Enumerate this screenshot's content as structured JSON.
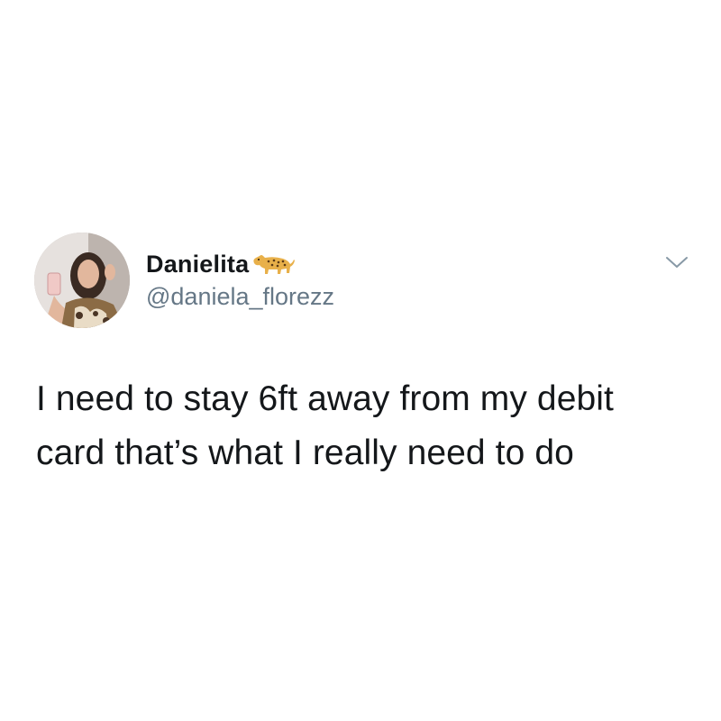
{
  "tweet": {
    "author": {
      "display_name": "Danielita",
      "emoji_icon": "leopard-icon",
      "handle": "@daniela_florezz",
      "avatar_icon": "profile-photo-avatar"
    },
    "menu_icon": "chevron-down-icon",
    "text": "I need to stay 6ft away from my debit card that’s what I really need to do"
  },
  "colors": {
    "text_primary": "#14171a",
    "text_secondary": "#657786",
    "background": "#ffffff",
    "chevron": "#8899a6"
  }
}
